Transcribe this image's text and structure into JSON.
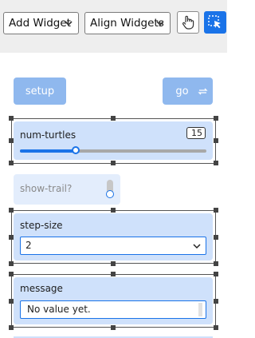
{
  "toolbar": {
    "add_widget": "Add Widget",
    "align_widgets": "Align Widgets",
    "hand_icon": "hand-pointer-icon",
    "select_icon": "selection-cursor-icon",
    "accent": "#1a73e8"
  },
  "widgets": {
    "setup": {
      "label": "setup"
    },
    "go": {
      "label": "go",
      "icon": "forever-loop-icon"
    },
    "num_turtles": {
      "label": "num-turtles",
      "value": "15",
      "fill_fraction": 0.3
    },
    "show_trail": {
      "label": "show-trail?"
    },
    "step_size": {
      "label": "step-size",
      "selected": "2"
    },
    "message": {
      "label": "message",
      "value": "No value yet."
    }
  }
}
